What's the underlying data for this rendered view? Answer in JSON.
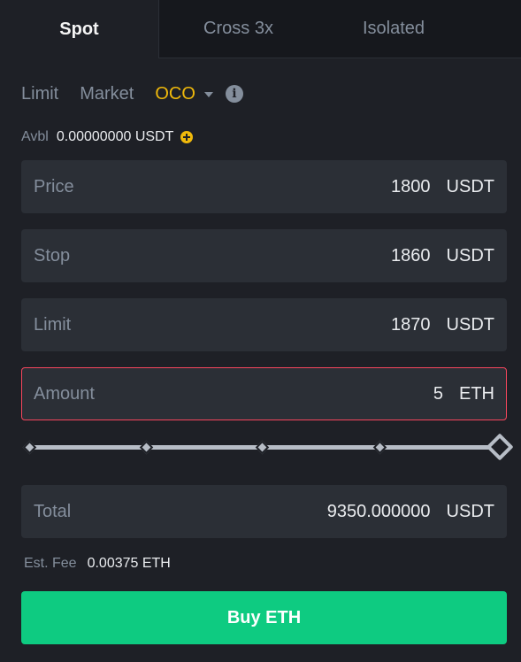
{
  "tabs": [
    {
      "label": "Spot",
      "active": true
    },
    {
      "label": "Cross 3x",
      "active": false
    },
    {
      "label": "Isolated",
      "active": false
    }
  ],
  "order_types": {
    "limit": "Limit",
    "market": "Market",
    "oco": "OCO",
    "selected": "OCO"
  },
  "icons": {
    "info": "i",
    "dropdown": "caret-down",
    "add_funds": "plus-circle"
  },
  "available": {
    "label": "Avbl",
    "value": "0.00000000 USDT"
  },
  "fields": {
    "price": {
      "label": "Price",
      "value": "1800",
      "unit": "USDT"
    },
    "stop": {
      "label": "Stop",
      "value": "1860",
      "unit": "USDT"
    },
    "limit": {
      "label": "Limit",
      "value": "1870",
      "unit": "USDT"
    },
    "amount": {
      "label": "Amount",
      "value": "5",
      "unit": "ETH",
      "error": true
    },
    "total": {
      "label": "Total",
      "value": "9350.000000",
      "unit": "USDT"
    }
  },
  "slider": {
    "percent": 100,
    "marks": [
      0,
      25,
      50,
      75,
      100
    ]
  },
  "fee": {
    "label": "Est. Fee",
    "value": "0.00375 ETH"
  },
  "buy_button": {
    "label": "Buy ETH"
  },
  "colors": {
    "accent": "#f0b90b",
    "buy": "#0ecb81",
    "error": "#f6465d",
    "background": "#1e2026",
    "field_bg": "#2b2f36",
    "muted_text": "#848e9c"
  }
}
